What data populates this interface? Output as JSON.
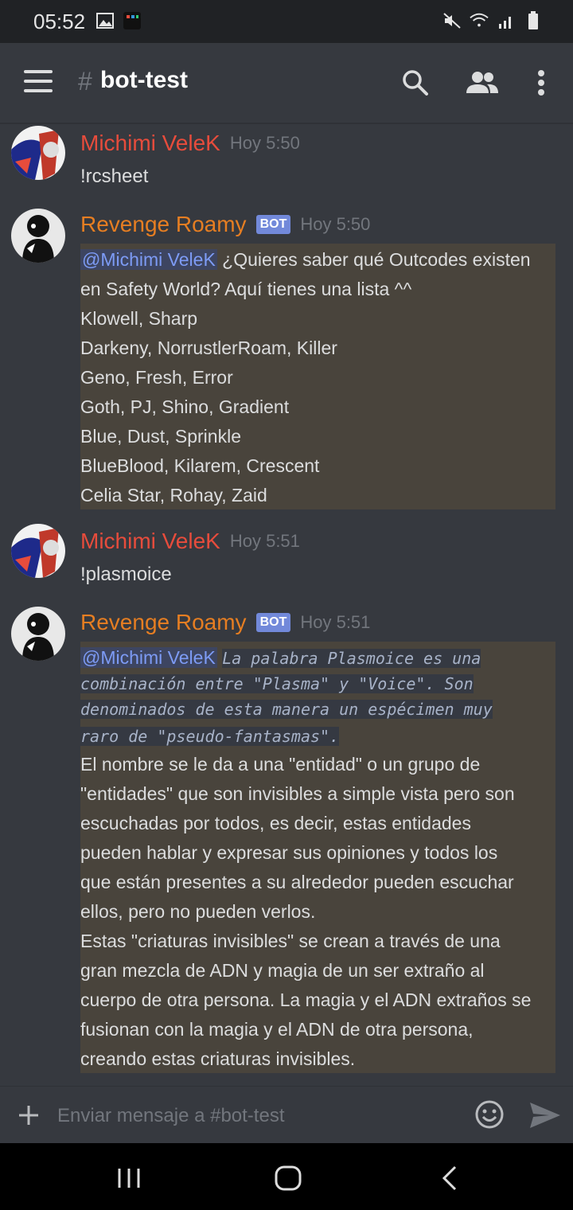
{
  "status_bar": {
    "time": "05:52"
  },
  "header": {
    "hash": "#",
    "channel": "bot-test"
  },
  "messages": [
    {
      "author": "Michimi VeleK",
      "time": "Hoy 5:50",
      "text": "!rcsheet"
    },
    {
      "author": "Revenge Roamy",
      "bot_tag": "BOT",
      "time": "Hoy 5:50",
      "mention": "@Michimi VeleK",
      "lines": [
        " ¿Quieres saber qué Outcodes existen",
        "en Safety World? Aquí tienes una lista ^^",
        "Klowell, Sharp",
        "Darkeny, NorrustlerRoam, Killer",
        "Geno, Fresh, Error",
        "Goth, PJ, Shino, Gradient",
        "Blue, Dust, Sprinkle",
        "BlueBlood, Kilarem, Crescent",
        "Celia Star, Rohay, Zaid"
      ]
    },
    {
      "author": "Michimi VeleK",
      "time": "Hoy 5:51",
      "text": "!plasmoice"
    },
    {
      "author": "Revenge Roamy",
      "bot_tag": "BOT",
      "time": "Hoy 5:51",
      "mention": "@Michimi VeleK",
      "italic_lines": [
        "La palabra Plasmoice es una",
        "combinación entre \"Plasma\" y \"Voice\". Son",
        "denominados de esta manera un espécimen muy",
        "raro de \"pseudo-fantasmas\"."
      ],
      "lines": [
        "El nombre se le da a una \"entidad\" o un grupo de",
        "\"entidades\" que son invisibles a simple vista pero son",
        "escuchadas por todos, es decir, estas entidades",
        "pueden hablar y expresar sus opiniones y todos los",
        "que están presentes a su alrededor pueden escuchar",
        "ellos, pero no pueden verlos.",
        "Estas \"criaturas invisibles\" se crean a través de una",
        "gran mezcla de ADN y magia de un ser extraño al",
        "cuerpo de otra persona. La magia y el ADN extraños se",
        "fusionan con la magia y el ADN de otra persona,",
        "creando estas criaturas invisibles."
      ]
    }
  ],
  "composer": {
    "placeholder": "Enviar mensaje a #bot-test"
  },
  "colors": {
    "user_red": "#e74c3c",
    "bot_orange": "#e67e22",
    "bot_tag": "#7289da",
    "mention_bg": "#49443c"
  }
}
